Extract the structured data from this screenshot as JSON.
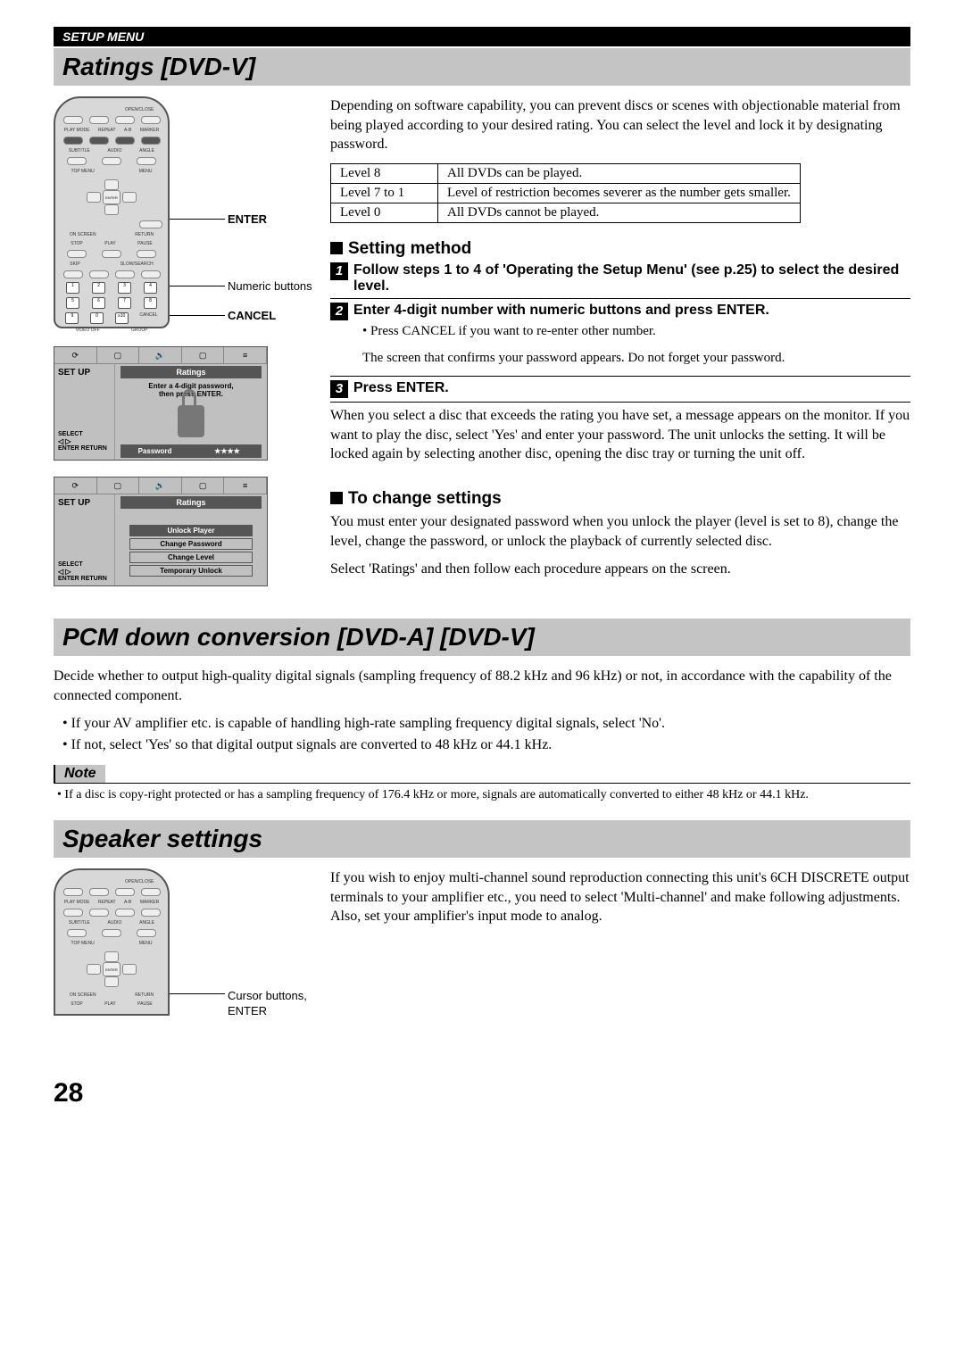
{
  "header": {
    "setup_menu": "SETUP MENU"
  },
  "ratings": {
    "heading": "Ratings [DVD-V]",
    "remote": {
      "labels": {
        "open_close": "OPEN/CLOSE",
        "play_mode": "PLAY MODE",
        "repeat": "REPEAT",
        "a_b": "A-B",
        "marker": "MARKER",
        "subtitle": "SUBTITLE",
        "audio": "AUDIO",
        "angle": "ANGLE",
        "top_menu": "TOP MENU",
        "menu": "MENU",
        "on_screen": "ON SCREEN",
        "enter": "ENTER",
        "return": "RETURN",
        "stop": "STOP",
        "play": "PLAY",
        "pause": "PAUSE",
        "skip": "SKIP",
        "slow_search": "SLOW/SEARCH",
        "cancel": "CANCEL",
        "video_off": "VIDEO OFF",
        "group": "GROUP"
      },
      "callouts": {
        "enter": "ENTER",
        "numeric": "Numeric buttons",
        "cancel": "CANCEL"
      }
    },
    "osd1": {
      "setup": "SET UP",
      "tab": "Ratings",
      "msg1": "Enter a 4-digit password,",
      "msg2": "then press ENTER.",
      "select": "SELECT",
      "enter_return": "ENTER  RETURN",
      "pw_label": "Password",
      "pw_value": "★★★★"
    },
    "osd2": {
      "setup": "SET UP",
      "tab": "Ratings",
      "options": [
        "Unlock Player",
        "Change Password",
        "Change Level",
        "Temporary Unlock"
      ],
      "select": "SELECT",
      "enter_return": "ENTER  RETURN"
    },
    "intro": "Depending on software capability, you can prevent discs or scenes with objectionable material from being played according to your desired rating. You can select the level and lock it by designating password.",
    "table": {
      "r1c1": "Level 8",
      "r1c2": "All DVDs can be played.",
      "r2c1": "Level 7 to 1",
      "r2c2": "Level of restriction becomes severer as the number gets smaller.",
      "r3c1": "Level 0",
      "r3c2": "All DVDs cannot be played."
    },
    "setting_method_h": "Setting method",
    "step1": "Follow steps 1 to 4 of 'Operating the Setup Menu' (see p.25) to select the desired level.",
    "step2": "Enter 4-digit number with numeric buttons and press ENTER.",
    "step2_b1": "• Press CANCEL if you want to re-enter other number.",
    "step2_p": "The screen that confirms your password appears. Do not forget your password.",
    "step3": "Press ENTER.",
    "after": "When you select a disc that exceeds the rating you have set, a message appears on the monitor. If you want to play the disc, select 'Yes' and enter your password. The unit unlocks the setting. It will be locked again by selecting another disc, opening the disc tray or turning the unit off.",
    "to_change_h": "To change settings",
    "to_change_p1": "You must enter your designated password when you unlock the player (level is set to 8), change the level, change the password, or unlock the playback of currently selected disc.",
    "to_change_p2": "Select 'Ratings' and then follow each procedure appears on the screen."
  },
  "pcm": {
    "heading": "PCM down conversion [DVD-A] [DVD-V]",
    "intro": "Decide whether to output high-quality digital signals (sampling frequency of 88.2 kHz and 96 kHz) or not, in accordance with the capability of the connected component.",
    "b1": "• If your AV amplifier etc. is capable of handling high-rate sampling frequency digital signals, select 'No'.",
    "b2": "• If not, select 'Yes' so that digital output signals are converted to 48 kHz or 44.1 kHz.",
    "note_label": "Note",
    "note": "• If a disc is copy-right protected or has a sampling frequency of 176.4 kHz or more, signals are automatically converted to either 48 kHz or 44.1 kHz."
  },
  "speaker": {
    "heading": "Speaker settings",
    "remote_callout_cursor": "Cursor buttons,",
    "remote_callout_enter": "ENTER",
    "remote": {
      "labels": {
        "open_close": "OPEN/CLOSE",
        "play_mode": "PLAY MODE",
        "repeat": "REPEAT",
        "a_b": "A-B",
        "marker": "MARKER",
        "subtitle": "SUBTITLE",
        "audio": "AUDIO",
        "angle": "ANGLE",
        "top_menu": "TOP MENU",
        "menu": "MENU",
        "on_screen": "ON SCREEN",
        "enter": "ENTER",
        "return": "RETURN",
        "stop": "STOP",
        "play": "PLAY",
        "pause": "PAUSE"
      }
    },
    "p1": "If you wish to enjoy multi-channel sound reproduction connecting this unit's 6CH DISCRETE output terminals to your amplifier etc., you need to select 'Multi-channel' and make following adjustments. Also, set your amplifier's input mode to analog."
  },
  "page_number": "28"
}
